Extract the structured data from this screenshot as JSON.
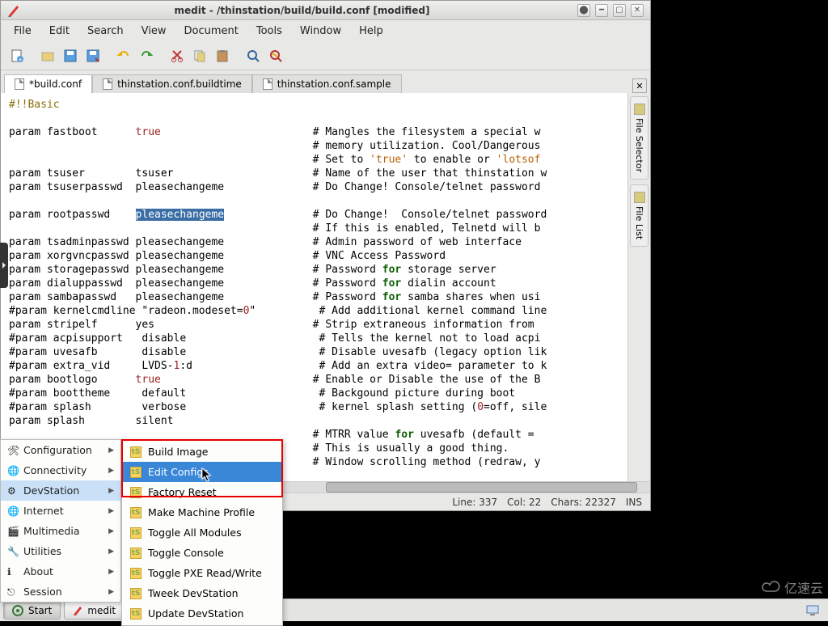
{
  "titlebar": {
    "app": "medit",
    "path": "/thinstation/build/build.conf",
    "state": "[modified]",
    "full": "medit - /thinstation/build/build.conf [modified]"
  },
  "menubar": [
    "File",
    "Edit",
    "Search",
    "View",
    "Document",
    "Tools",
    "Window",
    "Help"
  ],
  "tabs": [
    {
      "label": "*build.conf",
      "active": true
    },
    {
      "label": "thinstation.conf.buildtime"
    },
    {
      "label": "thinstation.conf.sample"
    }
  ],
  "right_panels": {
    "selector": "File Selector",
    "list": "File List"
  },
  "status": {
    "line": "Line: 337",
    "col": "Col: 22",
    "chars": "Chars: 22327",
    "mode": "INS"
  },
  "editor_lines": [
    "#!!Basic",
    "",
    "param fastboot      true                        # Mangles the filesystem a special w",
    "                                                # memory utilization. Cool/Dangerous",
    "                                                # Set to 'true' to enable or 'lotsof",
    "param tsuser        tsuser                      # Name of the user that thinstation w",
    "param tsuserpasswd  pleasechangeme              # Do Change! Console/telnet password",
    "",
    "param rootpasswd    pleasechangeme              # Do Change!  Console/telnet password",
    "                                                # If this is enabled, Telnetd will b",
    "param tsadminpasswd pleasechangeme              # Admin password of web interface",
    "param xorgvncpasswd pleasechangeme              # VNC Access Password",
    "param storagepasswd pleasechangeme              # Password for storage server",
    "param dialuppasswd  pleasechangeme              # Password for dialin account",
    "param sambapasswd   pleasechangeme              # Password for samba shares when usi",
    "#param kernelcmdline \"radeon.modeset=0\"          # Add additional kernel command line",
    "param stripelf      yes                         # Strip extraneous information from",
    "#param acpisupport   disable                     # Tells the kernel not to load acpi",
    "#param uvesafb       disable                     # Disable uvesafb (legacy option lik",
    "#param extra_vid     LVDS-1:d                    # Add an extra video= parameter to k",
    "param bootlogo      true                        # Enable or Disable the use of the B",
    "#param boottheme     default                     # Backgound picture during boot",
    "#param splash        verbose                     # kernel splash setting (0=off, sile",
    "param splash        silent",
    "                                                # MTRR value for uvesafb (default =",
    "                                                # This is usually a good thing.",
    "                                                # Window scrolling method (redraw, y"
  ],
  "selection_word": "pleasechangeme",
  "start_menu": {
    "items": [
      {
        "label": "Configuration",
        "icon": "tools-icon"
      },
      {
        "label": "Connectivity",
        "icon": "globe-icon"
      },
      {
        "label": "DevStation",
        "icon": "gear-icon",
        "selected": true
      },
      {
        "label": "Internet",
        "icon": "globe-icon"
      },
      {
        "label": "Multimedia",
        "icon": "media-icon"
      },
      {
        "label": "Utilities",
        "icon": "wrench-icon"
      },
      {
        "label": "About",
        "icon": "info-icon"
      },
      {
        "label": "Session",
        "icon": "exit-icon"
      }
    ]
  },
  "submenu": {
    "items": [
      {
        "label": "Build Image"
      },
      {
        "label": "Edit Configs",
        "selected": true
      },
      {
        "label": "Factory Reset"
      },
      {
        "label": "Make Machine Profile"
      },
      {
        "label": "Toggle All Modules"
      },
      {
        "label": "Toggle Console"
      },
      {
        "label": "Toggle PXE Read/Write"
      },
      {
        "label": "Tweek DevStation"
      },
      {
        "label": "Update DevStation"
      }
    ],
    "icon_text": "tS"
  },
  "taskbar": {
    "start": "Start",
    "app": "medit"
  },
  "watermark": "亿速云"
}
